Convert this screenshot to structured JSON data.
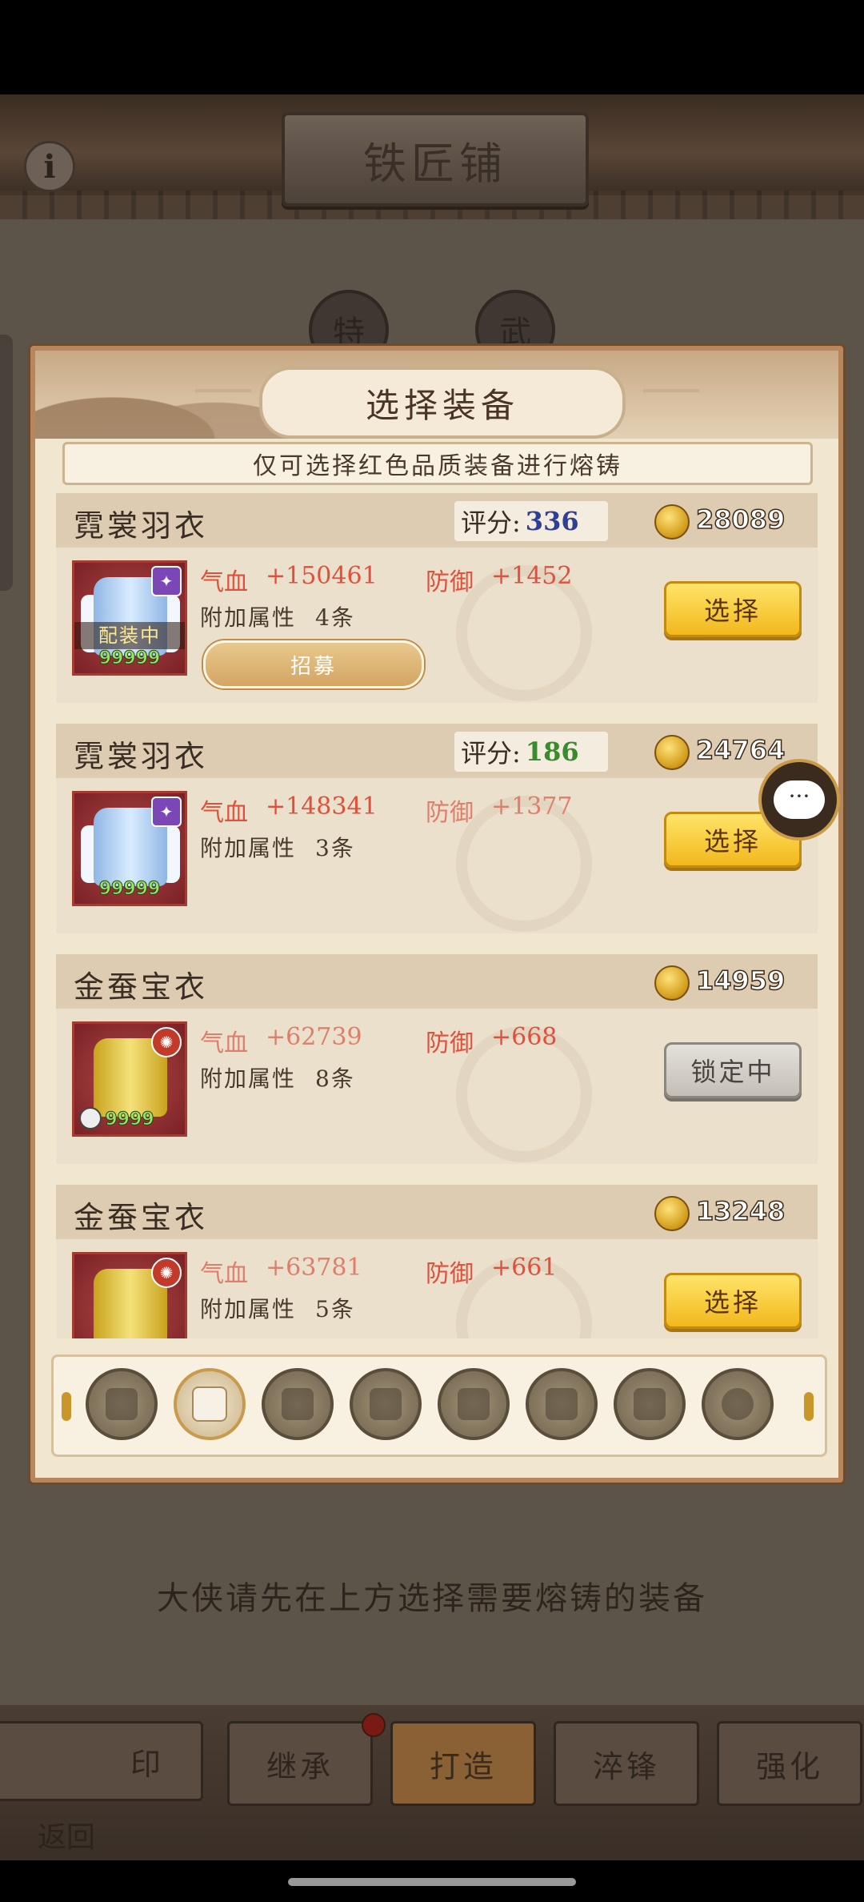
{
  "top": {
    "title": "铁匠铺",
    "info_icon": "i",
    "tab_a": "特",
    "tab_b": "武"
  },
  "modal": {
    "title": "选择装备",
    "notice": "仅可选择红色品质装备进行熔铸",
    "items": [
      {
        "name": "霓裳羽衣",
        "score_label": "评分:",
        "score": "336",
        "score_color": "#2f3f94",
        "coins": "28089",
        "level": "99999",
        "equipped": "配装中",
        "hp_label": "气血",
        "hp": "+150461",
        "def_label": "防御",
        "def": "+1452",
        "attr_label": "附加属性",
        "attr_count": "4条",
        "recruit": "招募",
        "action": "选择"
      },
      {
        "name": "霓裳羽衣",
        "score_label": "评分:",
        "score": "186",
        "score_color": "#3a8a2e",
        "coins": "24764",
        "level": "99999",
        "hp_label": "气血",
        "hp": "+148341",
        "def_label": "防御",
        "def": "+1377",
        "attr_label": "附加属性",
        "attr_count": "3条",
        "action": "选择"
      },
      {
        "name": "金蚕宝衣",
        "coins": "14959",
        "level": "9999",
        "hp_label": "气血",
        "hp": "+62739",
        "def_label": "防御",
        "def": "+668",
        "attr_label": "附加属性",
        "attr_count": "8条",
        "action": "锁定中"
      },
      {
        "name": "金蚕宝衣",
        "coins": "13248",
        "hp_label": "气血",
        "hp": "+63781",
        "def_label": "防御",
        "def": "+661",
        "attr_label": "附加属性",
        "attr_count": "5条",
        "action": "选择"
      }
    ],
    "categories": [
      "weapon-icon",
      "armor-icon",
      "belt-icon",
      "boots-icon",
      "hat-icon",
      "helmet-icon",
      "bracer-icon",
      "ring-icon"
    ]
  },
  "hint": "大侠请先在上方选择需要熔铸的装备",
  "bottom_tabs": [
    "印",
    "继承",
    "打造",
    "淬锋",
    "强化"
  ],
  "back_label": "返回"
}
